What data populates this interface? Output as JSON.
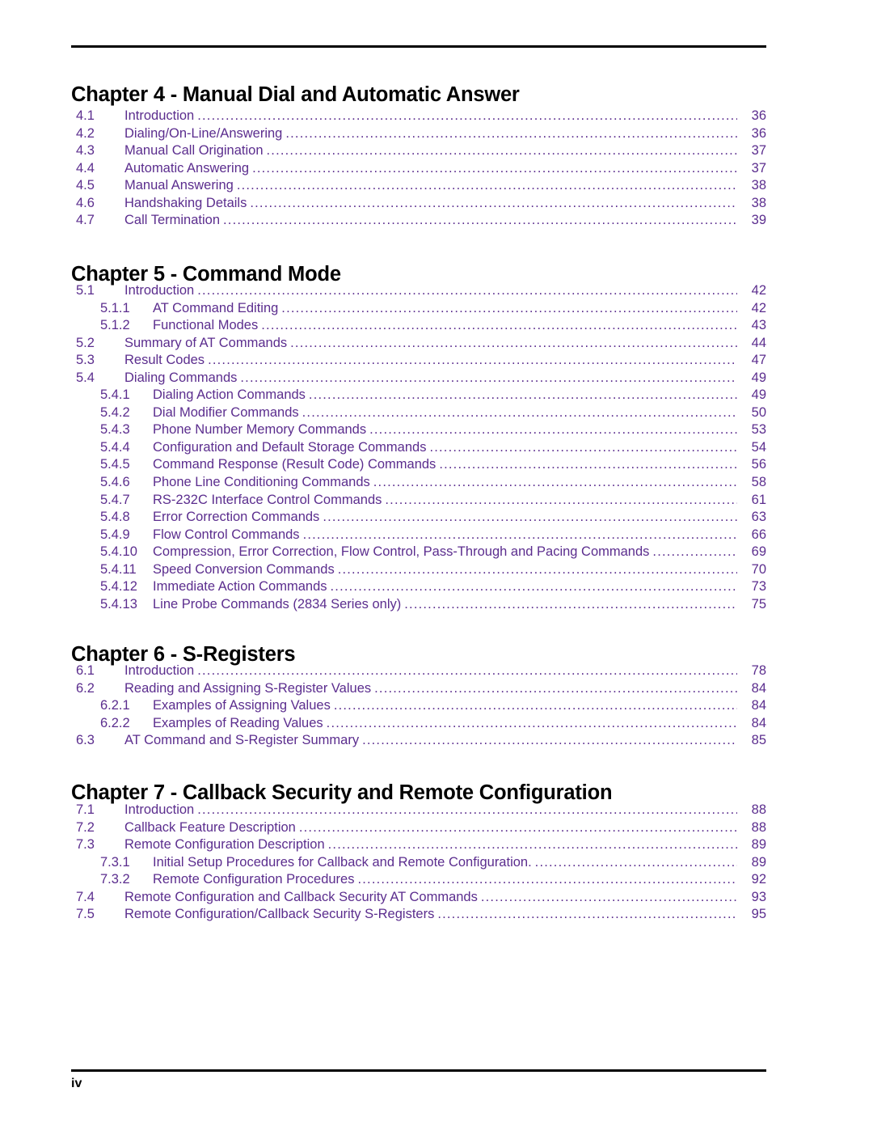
{
  "document": {
    "footer_page_label": "iv",
    "accent_color": "#5B2D8E",
    "heading_color": "#000000",
    "leader_char": "."
  },
  "chapters": [
    {
      "heading": "Chapter 4 - Manual Dial and Automatic Answer",
      "entries": [
        {
          "number": "4.1",
          "label": "Introduction",
          "page": "36",
          "level": 1
        },
        {
          "number": "4.2",
          "label": "Dialing/On-Line/Answering",
          "page": "36",
          "level": 1
        },
        {
          "number": "4.3",
          "label": "Manual Call Origination",
          "page": "37",
          "level": 1
        },
        {
          "number": "4.4",
          "label": "Automatic Answering",
          "page": "37",
          "level": 1
        },
        {
          "number": "4.5",
          "label": "Manual Answering",
          "page": "38",
          "level": 1
        },
        {
          "number": "4.6",
          "label": "Handshaking Details",
          "page": "38",
          "level": 1
        },
        {
          "number": "4.7",
          "label": "Call Termination",
          "page": "39",
          "level": 1
        }
      ]
    },
    {
      "heading": "Chapter 5 - Command Mode",
      "entries": [
        {
          "number": "5.1",
          "label": "Introduction",
          "page": "42",
          "level": 1
        },
        {
          "number": "5.1.1",
          "label": "AT Command Editing",
          "page": "42",
          "level": 2
        },
        {
          "number": "5.1.2",
          "label": "Functional Modes",
          "page": "43",
          "level": 2
        },
        {
          "number": "5.2",
          "label": "Summary of AT Commands",
          "page": "44",
          "level": 1
        },
        {
          "number": "5.3",
          "label": "Result Codes",
          "page": "47",
          "level": 1
        },
        {
          "number": "5.4",
          "label": "Dialing Commands",
          "page": "49",
          "level": 1
        },
        {
          "number": "5.4.1",
          "label": "Dialing Action Commands",
          "page": "49",
          "level": 2
        },
        {
          "number": "5.4.2",
          "label": "Dial Modifier Commands",
          "page": "50",
          "level": 2
        },
        {
          "number": "5.4.3",
          "label": "Phone Number Memory Commands",
          "page": "53",
          "level": 2
        },
        {
          "number": "5.4.4",
          "label": "Configuration and Default Storage Commands",
          "page": "54",
          "level": 2
        },
        {
          "number": "5.4.5",
          "label": "Command Response (Result Code) Commands",
          "page": "56",
          "level": 2
        },
        {
          "number": "5.4.6",
          "label": "Phone Line Conditioning Commands",
          "page": "58",
          "level": 2
        },
        {
          "number": "5.4.7",
          "label": "RS-232C Interface Control Commands",
          "page": "61",
          "level": 2
        },
        {
          "number": "5.4.8",
          "label": "Error Correction Commands",
          "page": "63",
          "level": 2
        },
        {
          "number": "5.4.9",
          "label": "Flow Control Commands",
          "page": "66",
          "level": 2
        },
        {
          "number": "5.4.10",
          "label": "Compression, Error Correction, Flow Control, Pass-Through and Pacing Commands",
          "page": "69",
          "level": 2
        },
        {
          "number": "5.4.11",
          "label": "Speed Conversion Commands",
          "page": "70",
          "level": 2
        },
        {
          "number": "5.4.12",
          "label": "Immediate Action Commands",
          "page": "73",
          "level": 2
        },
        {
          "number": "5.4.13",
          "label": "Line Probe Commands (2834 Series only)",
          "page": "75",
          "level": 2
        }
      ]
    },
    {
      "heading": "Chapter 6 - S-Registers",
      "entries": [
        {
          "number": "6.1",
          "label": "Introduction",
          "page": "78",
          "level": 1
        },
        {
          "number": "6.2",
          "label": "Reading and Assigning S-Register Values",
          "page": "84",
          "level": 1
        },
        {
          "number": "6.2.1",
          "label": "Examples of Assigning Values",
          "page": "84",
          "level": 2
        },
        {
          "number": "6.2.2",
          "label": "Examples of Reading Values",
          "page": "84",
          "level": 2
        },
        {
          "number": "6.3",
          "label": "AT Command and S-Register Summary",
          "page": "85",
          "level": 1
        }
      ]
    },
    {
      "heading": "Chapter 7 - Callback Security and Remote Configuration",
      "entries": [
        {
          "number": "7.1",
          "label": "Introduction",
          "page": "88",
          "level": 1
        },
        {
          "number": "7.2",
          "label": "Callback Feature Description",
          "page": "88",
          "level": 1
        },
        {
          "number": "7.3",
          "label": "Remote Configuration Description",
          "page": "89",
          "level": 1
        },
        {
          "number": "7.3.1",
          "label": "Initial Setup Procedures for Callback and Remote Configuration.",
          "page": "89",
          "level": 2
        },
        {
          "number": "7.3.2",
          "label": "Remote Configuration Procedures",
          "page": "92",
          "level": 2
        },
        {
          "number": "7.4",
          "label": "Remote Configuration and Callback Security AT Commands",
          "page": "93",
          "level": 1
        },
        {
          "number": "7.5",
          "label": "Remote Configuration/Callback Security S-Registers",
          "page": "95",
          "level": 1
        }
      ]
    }
  ]
}
